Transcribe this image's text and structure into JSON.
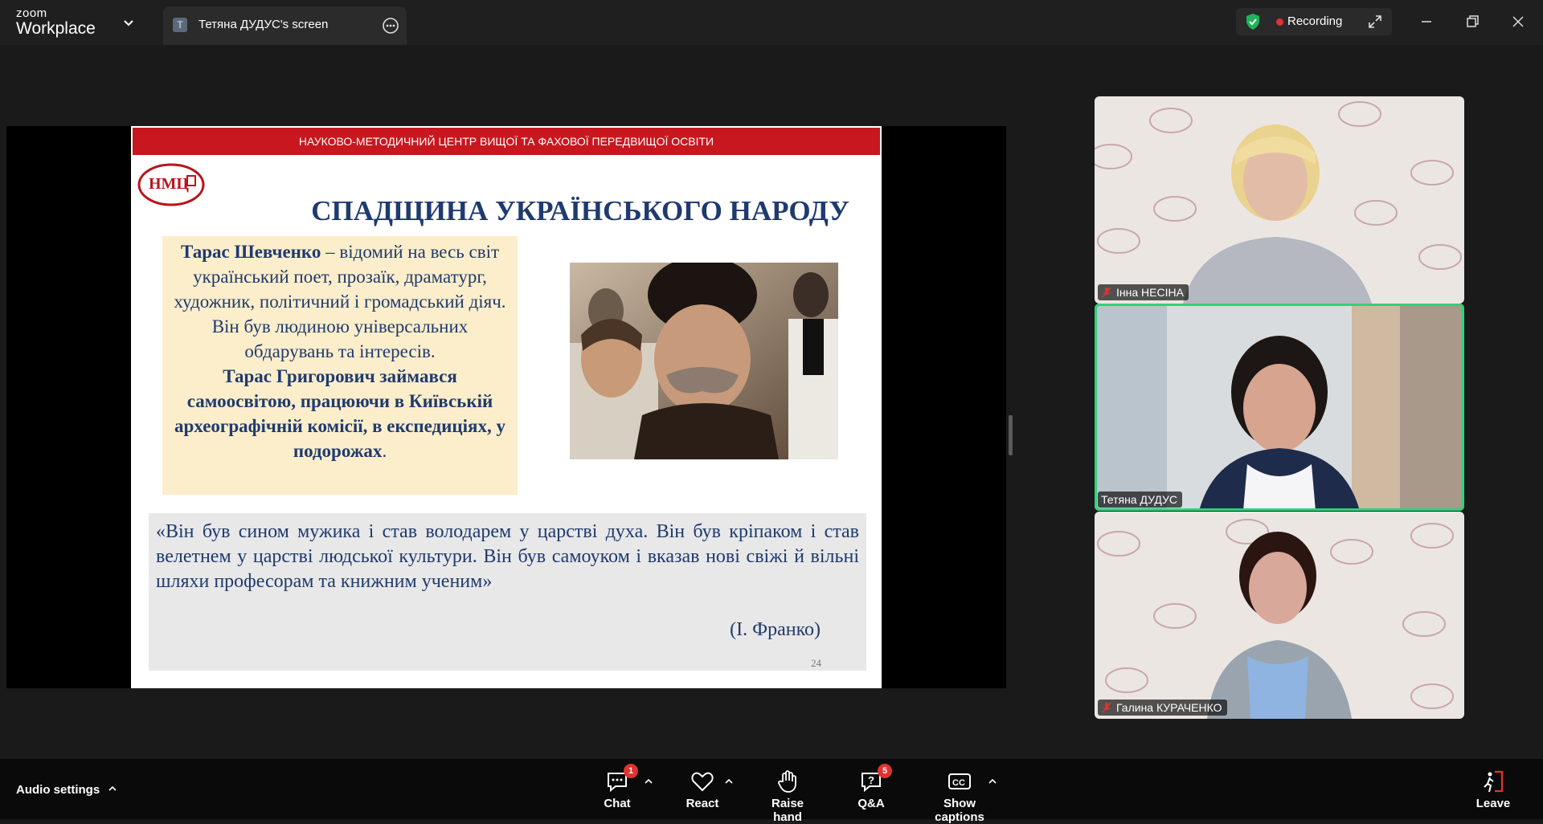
{
  "app": {
    "brand_line1": "zoom",
    "brand_line2": "Workplace"
  },
  "tab": {
    "avatar_letter": "T",
    "title": "Тетяна ДУДУС's screen"
  },
  "recording": {
    "label": "Recording",
    "status_color": "#e0332e",
    "shield_color": "#1fb35a"
  },
  "slide": {
    "band": "НАУКОВО-МЕТОДИЧНИЙ ЦЕНТР ВИЩОЇ ТА ФАХОВОЇ ПЕРЕДВИЩОЇ ОСВІТИ",
    "logo_text": "НМЦ",
    "title": "СПАДЩИНА УКРАЇНСЬКОГО НАРОДУ",
    "box_name": "Тарас Шевченко",
    "box_intro": " – відомий на весь світ український поет, прозаїк, драматург, художник, політичний і громадський діяч. Він був людиною універсальних обдарувань та інтересів.",
    "box_bold": "Тарас Григорович займався самоосвітою, працюючи в Київській археографічній комісії, в експедиціях, у подорожах",
    "box_end": ".",
    "quote": "«Він був сином мужика і став володарем у царстві духа. Він був кріпаком і став велетнем у царстві людської культури. Він був самоуком і вказав нові свіжі й вільні шляхи професорам та книжним ученим»",
    "quote_author": "(І. Франко)",
    "page_number": "24"
  },
  "participants": [
    {
      "name": "Інна НЕСІНА",
      "muted": true
    },
    {
      "name": "Тетяна ДУДУС",
      "muted": false,
      "active_speaker": true
    },
    {
      "name": "Галина КУРАЧЕНКО",
      "muted": true
    }
  ],
  "bottombar": {
    "audio_settings": "Audio settings",
    "chat": {
      "label": "Chat",
      "badge": "1"
    },
    "react": {
      "label": "React"
    },
    "raise_hand": {
      "label": "Raise hand"
    },
    "qa": {
      "label": "Q&A",
      "badge": "5"
    },
    "captions": {
      "label": "Show captions"
    },
    "leave": {
      "label": "Leave"
    }
  },
  "colors": {
    "accent_green": "#31d17a",
    "slide_red": "#c8171f",
    "slide_navy": "#1f3a6e"
  }
}
